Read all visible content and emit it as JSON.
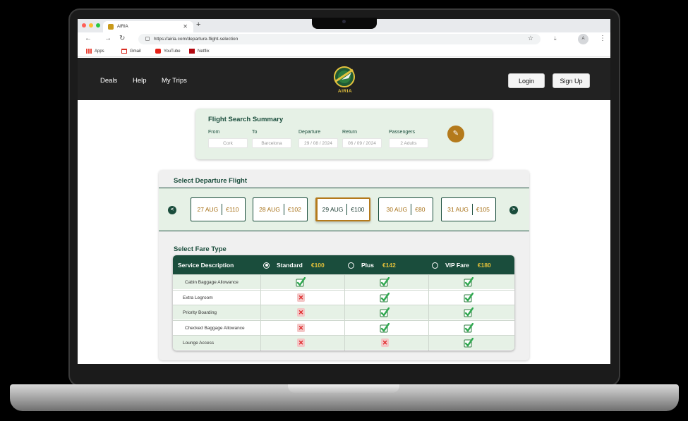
{
  "browser": {
    "tab_title": "AIRIA",
    "url": "https://airia.com/departure-flight-selection",
    "avatar_letter": "A",
    "bookmarks": [
      "Apps",
      "Gmail",
      "YouTube",
      "Netflix"
    ]
  },
  "header": {
    "nav": [
      "Deals",
      "Help",
      "My Trips"
    ],
    "logo_text": "AIRIA",
    "login_label": "Login",
    "signup_label": "Sign Up"
  },
  "summary": {
    "title": "Flight Search Summary",
    "fields": [
      {
        "label": "From",
        "value": "Cork"
      },
      {
        "label": "To",
        "value": "Barcelona"
      },
      {
        "label": "Departure",
        "value": "29 / 08 / 2024"
      },
      {
        "label": "Return",
        "value": "06 / 09 / 2024"
      },
      {
        "label": "Passengers",
        "value": "2 Adults"
      }
    ]
  },
  "departure": {
    "title": "Select Departure Flight",
    "prev_glyph": "<",
    "next_glyph": ">",
    "dates": [
      {
        "date": "27 AUG",
        "price": "€110",
        "selected": false
      },
      {
        "date": "28 AUG",
        "price": "€102",
        "selected": false
      },
      {
        "date": "29 AUG",
        "price": "€100",
        "selected": true
      },
      {
        "date": "30 AUG",
        "price": "€80",
        "selected": false
      },
      {
        "date": "31 AUG",
        "price": "€105",
        "selected": false
      }
    ]
  },
  "fare": {
    "title": "Select Fare Type",
    "header_label": "Service Description",
    "columns": [
      {
        "name": "Standard",
        "price": "€100",
        "selected": true
      },
      {
        "name": "Plus",
        "price": "€142",
        "selected": false
      },
      {
        "name": "VIP Fare",
        "price": "€180",
        "selected": false
      }
    ],
    "rows": [
      {
        "label": "Cabin Baggage Allowance",
        "included": [
          true,
          true,
          true
        ]
      },
      {
        "label": "Extra Legroom",
        "included": [
          false,
          true,
          true
        ]
      },
      {
        "label": "Priority Boarding",
        "included": [
          false,
          true,
          true
        ]
      },
      {
        "label": "Checked Baggage Allowance",
        "included": [
          false,
          true,
          true
        ]
      },
      {
        "label": "Lounge Access",
        "included": [
          false,
          false,
          true
        ]
      }
    ]
  },
  "colors": {
    "brand_green": "#1a4d3c",
    "accent_gold": "#b47a1c",
    "light_green": "#e6f1e6",
    "header_dark": "#222222"
  }
}
